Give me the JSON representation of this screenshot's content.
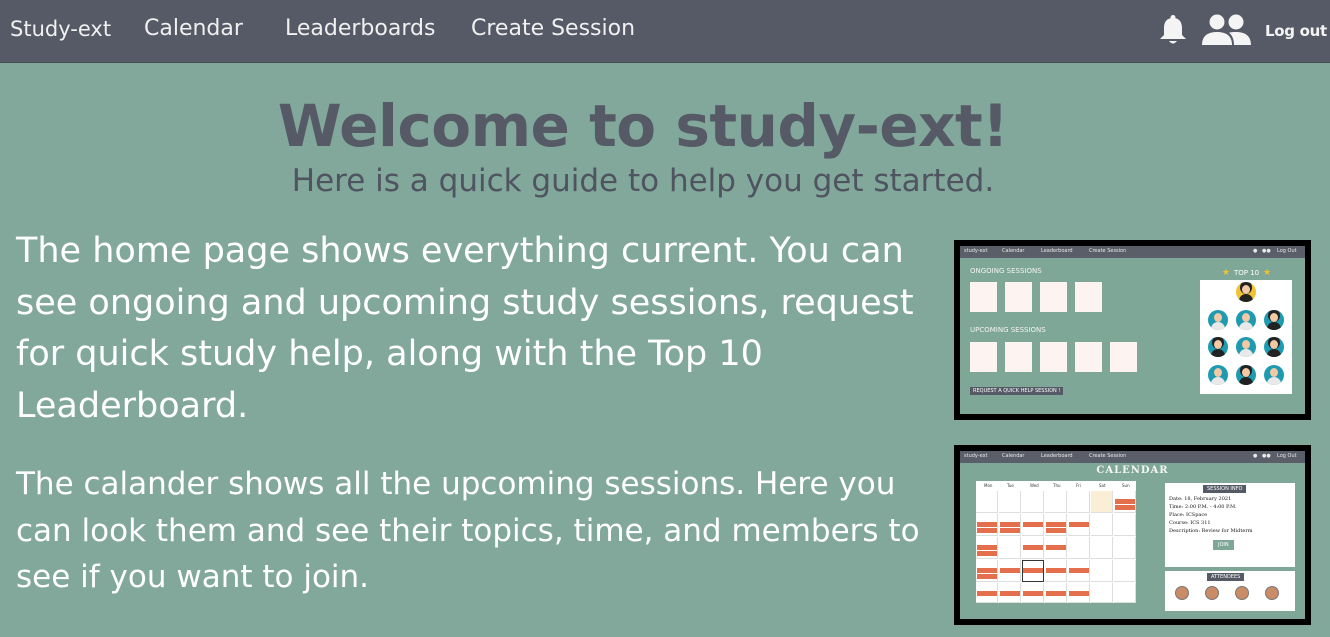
{
  "nav": {
    "brand": "Study-ext",
    "links": [
      "Calendar",
      "Leaderboards",
      "Create Session"
    ],
    "icons": [
      "bell-icon",
      "users-icon"
    ],
    "logout": "Log out"
  },
  "hero": {
    "title": "Welcome to study-ext!",
    "subtitle": "Here is a quick guide to help you get started."
  },
  "guide": {
    "home_text": "The home page shows everything current. You can see ongoing and upcoming study sessions, request for quick study help, along with the Top 10 Leaderboard.",
    "calendar_text": "The calander shows all the upcoming sessions. Here you can look them and see their topics, time, and members to see if you want to join."
  },
  "home_preview": {
    "nav": [
      "study-ext",
      "Calendar",
      "Leaderboard",
      "Create Session",
      "Log Out"
    ],
    "ongoing_label": "ONGOING SESSIONS",
    "upcoming_label": "UPCOMING SESSIONS",
    "quick_help": "REQUEST A QUICK HELP SESSION !",
    "top10": "TOP 10"
  },
  "calendar_preview": {
    "nav": [
      "study-ext",
      "Calendar",
      "Leaderboard",
      "Create Session",
      "Log Out"
    ],
    "title": "CALENDAR",
    "days": [
      "Mon",
      "Tue",
      "Wed",
      "Thu",
      "Fri",
      "Sat",
      "Sun"
    ],
    "session_info_label": "SESSION INFO",
    "date": "Date: 18, February 2021",
    "time": "Time: 2:00 P.M. - 4:00 P.M.",
    "place": "Place: ICSpace",
    "course": "Course: ICS 311",
    "description": "Description: Review for Midterm",
    "join": "JOIN",
    "attendees_label": "ATTENDEES"
  },
  "colors": {
    "background": "#81a89a",
    "navbar": "#565a66",
    "title": "#555a66",
    "event": "#e46f4c"
  }
}
